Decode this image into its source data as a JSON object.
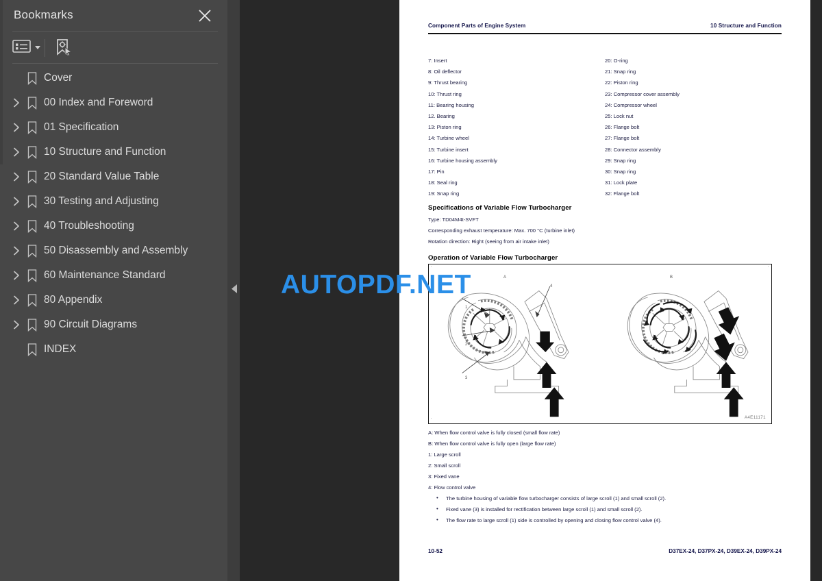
{
  "sidebar": {
    "title": "Bookmarks",
    "close_icon": "close-icon",
    "toolbar": {
      "options_icon": "list-options-icon",
      "select_bookmark_icon": "select-bookmark-icon"
    },
    "items": [
      {
        "label": "Cover",
        "expandable": false
      },
      {
        "label": "00 Index and Foreword",
        "expandable": true
      },
      {
        "label": "01 Specification",
        "expandable": true
      },
      {
        "label": "10 Structure and Function",
        "expandable": true
      },
      {
        "label": "20 Standard Value Table",
        "expandable": true
      },
      {
        "label": "30 Testing and Adjusting",
        "expandable": true
      },
      {
        "label": "40 Troubleshooting",
        "expandable": true
      },
      {
        "label": "50 Disassembly and Assembly",
        "expandable": true
      },
      {
        "label": "60 Maintenance Standard",
        "expandable": true
      },
      {
        "label": "80 Appendix",
        "expandable": true
      },
      {
        "label": "90 Circuit Diagrams",
        "expandable": true
      },
      {
        "label": "INDEX",
        "expandable": false
      }
    ]
  },
  "viewer": {
    "collapse_handle_icon": "chevron-left-icon"
  },
  "watermark": {
    "text": "AUTOPDF.NET",
    "color": "#2b8fe8"
  },
  "page": {
    "header_left": "Component Parts of Engine System",
    "header_right": "10 Structure and Function",
    "parts_left": [
      "7: Insert",
      "8: Oil deflector",
      "9: Thrust bearing",
      "10: Thrust ring",
      "11: Bearing housing",
      "12. Bearing",
      "13: Piston ring",
      "14: Turbine wheel",
      "15: Turbine insert",
      "16: Turbine housing assembly",
      "17: Pin",
      "18: Seal ring",
      "19: Snap ring"
    ],
    "parts_right": [
      "20: O-ring",
      "21: Snap ring",
      "22: Piston ring",
      "23: Compressor cover assembly",
      "24: Compressor wheel",
      "25: Lock nut",
      "26: Flange bolt",
      "27: Flange bolt",
      "28: Connector assembly",
      "29: Snap ring",
      "30: Snap ring",
      "31: Lock plate",
      "32: Flange bolt"
    ],
    "spec_heading": "Specifications of Variable Flow Turbocharger",
    "spec_lines": [
      "Type: TD04M4t-SVFT",
      "Corresponding exhaust temperature: Max. 700 °C (turbine inlet)",
      "Rotation direction: Right (seeing from air intake inlet)"
    ],
    "operation_heading": "Operation of Variable Flow Turbocharger",
    "figure": {
      "label_a": "A",
      "label_b": "B",
      "callouts": [
        "1",
        "2",
        "3",
        "4"
      ],
      "code": "A4E11171"
    },
    "notes": [
      "A: When flow control valve is fully closed (small flow rate)",
      "B: When flow control valve is fully open (large flow rate)",
      "1: Large scroll",
      "2: Small scroll",
      "3: Fixed vane",
      "4: Flow control valve"
    ],
    "bullets": [
      "The turbine housing of variable flow turbocharger consists of large scroll (1) and small scroll (2).",
      "Fixed vane (3) is installed for rectification between large scroll (1) and small scroll (2).",
      "The flow rate to large scroll (1) side is controlled by opening and closing flow control valve (4)."
    ],
    "footer_left": "10-52",
    "footer_right": "D37EX-24, D37PX-24, D39EX-24, D39PX-24"
  }
}
